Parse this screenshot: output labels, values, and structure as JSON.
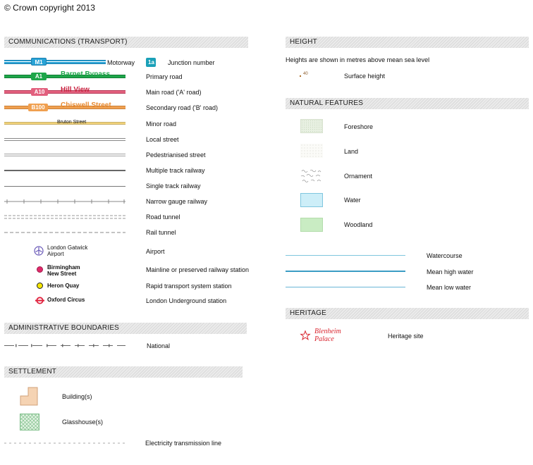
{
  "copyright": "© Crown copyright 2013",
  "communications": {
    "header": "COMMUNICATIONS (TRANSPORT)",
    "motorway": {
      "badge": "M1",
      "label": "Motorway",
      "junction_badge": "1a",
      "junction_label": "Junction number"
    },
    "primary": {
      "badge": "A1",
      "name": "Barnet Bypass",
      "label": "Primary road"
    },
    "main": {
      "badge": "A10",
      "name": "Hill View",
      "label": "Main road ('A' road)"
    },
    "secondary": {
      "badge": "B100",
      "name": "Chiswell Street",
      "label": "Secondary road ('B' road)"
    },
    "minor": {
      "name": "Bruton Street",
      "label": "Minor road"
    },
    "local": {
      "label": "Local street"
    },
    "pedestrian": {
      "label": "Pedestrianised street"
    },
    "multi_rail": {
      "label": "Multiple track railway"
    },
    "single_rail": {
      "label": "Single track railway"
    },
    "narrow_rail": {
      "label": "Narrow gauge railway"
    },
    "road_tunnel": {
      "label": "Road tunnel"
    },
    "rail_tunnel": {
      "label": "Rail tunnel"
    },
    "airport": {
      "name_line1": "London Gatwick",
      "name_line2": "Airport",
      "label": "Airport"
    },
    "mainline": {
      "name_line1": "Birmingham",
      "name_line2": "New Street",
      "label": "Mainline or preserved railway station"
    },
    "rapid": {
      "name": "Heron Quay",
      "label": "Rapid transport system station"
    },
    "underground": {
      "name": "Oxford Circus",
      "label": "London Underground station"
    }
  },
  "admin": {
    "header": "ADMINISTRATIVE BOUNDARIES",
    "national_label": "National"
  },
  "settlement": {
    "header": "SETTLEMENT",
    "buildings_label": "Building(s)",
    "glasshouse_label": "Glasshouse(s)",
    "electricity_label": "Electricity transmission line"
  },
  "height": {
    "header": "HEIGHT",
    "note": "Heights are shown in metres above mean sea level",
    "spot_value": "40",
    "surface_label": "Surface height"
  },
  "natural": {
    "header": "NATURAL FEATURES",
    "foreshore": "Foreshore",
    "land": "Land",
    "ornament": "Ornament",
    "water": "Water",
    "woodland": "Woodland",
    "watercourse": "Watercourse",
    "mean_high": "Mean high water",
    "mean_low": "Mean low water"
  },
  "heritage": {
    "header": "HERITAGE",
    "name_line1": "Blenheim",
    "name_line2": "Palace",
    "label": "Heritage site"
  },
  "colors": {
    "motorway": "#29a3d6",
    "primary": "#1ea64a",
    "main": "#e2607e",
    "secondary": "#f0a050",
    "minor": "#f2d37a",
    "water": "#cdeef8",
    "woodland": "#c9ecc3",
    "heritage": "#d9252f"
  }
}
